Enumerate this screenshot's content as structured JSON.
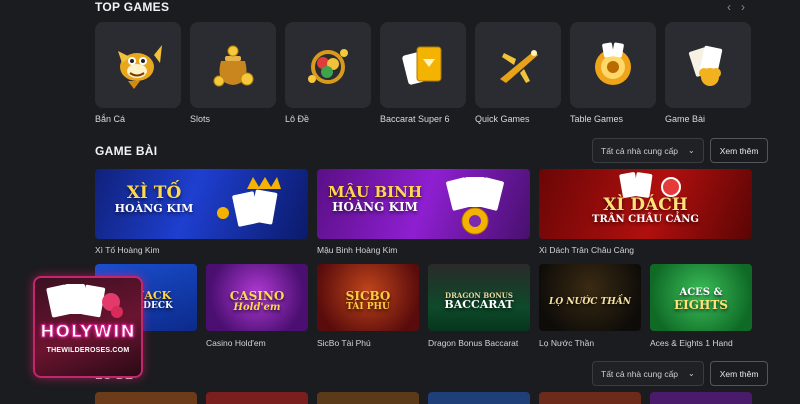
{
  "top_games": {
    "title": "TOP GAMES",
    "prev_label": "‹",
    "next_label": "›",
    "items": [
      {
        "label": "Bắn Cá",
        "icon": "golden-fish-icon"
      },
      {
        "label": "Slots",
        "icon": "money-bag-icon"
      },
      {
        "label": "Lô Đề",
        "icon": "lottery-balls-icon"
      },
      {
        "label": "Baccarat Super 6",
        "icon": "gold-cards-icon"
      },
      {
        "label": "Quick Games",
        "icon": "airplane-icon"
      },
      {
        "label": "Table Games",
        "icon": "roulette-chip-icon"
      },
      {
        "label": "Game Bài",
        "icon": "playing-cards-icon"
      }
    ]
  },
  "game_bai": {
    "title": "GAME BÀI",
    "filter_value": "Tất cả nhà cung cấp",
    "more_label": "Xem thêm",
    "featured": [
      {
        "label": "Xì Tố Hoàng Kim",
        "art_line1": "XÌ TỐ",
        "art_line2": "HOÀNG KIM"
      },
      {
        "label": "Mậu Binh Hoàng Kim",
        "art_line1": "MẬU BINH",
        "art_line2": "HOÀNG KIM"
      },
      {
        "label": "Xì Dách Trân Châu Cảng",
        "art_line1": "XÌ DÁCH",
        "art_line2": "TRÂN CHÂU CẢNG"
      }
    ],
    "games": [
      {
        "label": "ngle Deck",
        "art_line1": "CKJACK",
        "art_line2": "GLE DECK"
      },
      {
        "label": "Casino Hold'em",
        "art_line1": "CASINO",
        "art_line2": "Hold'em"
      },
      {
        "label": "SicBo Tài Phú",
        "art_line1": "SICBO",
        "art_line2": "TÀI PHÚ"
      },
      {
        "label": "Dragon Bonus Baccarat",
        "art_line1": "DRAGON BONUS",
        "art_line2": "BACCARAT"
      },
      {
        "label": "Lọ Nước Thần",
        "art_line1": "LỌ NƯỚC THẦN",
        "art_line2": ""
      },
      {
        "label": "Aces & Eights 1 Hand",
        "art_line1": "ACES &",
        "art_line2": "EIGHTS"
      }
    ]
  },
  "lo_de": {
    "title": "LÔ ĐỀ",
    "filter_value": "Tất cả nhà cung cấp",
    "more_label": "Xem thêm"
  },
  "watermark": {
    "brand": "HOLYWIN",
    "site": "THEWILDEROSES.COM"
  },
  "colors": {
    "background": "#1b1c1f",
    "tile": "#2b2c31",
    "gold": "#f5b301"
  }
}
